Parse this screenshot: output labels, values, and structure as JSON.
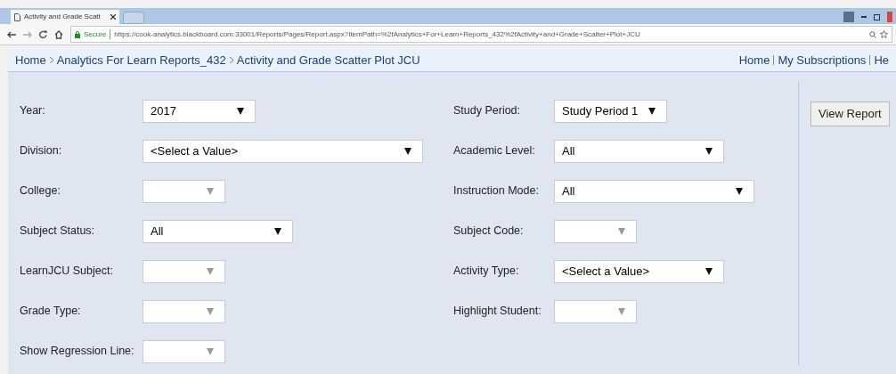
{
  "browser": {
    "tab_title": "Activity and Grade Scatt",
    "secure_label": "Secure",
    "url": "https://cook-analytics.blackboard.com:33001/Reports/Pages/Report.aspx?ItemPath=%2fAnalytics+For+Learn+Reports_432%2fActivity+and+Grade+Scatter+Plot+JCU"
  },
  "breadcrumb": [
    "Home",
    "Analytics For Learn Reports_432",
    "Activity and Grade Scatter Plot JCU"
  ],
  "top_links": [
    "Home",
    "My Subscriptions",
    "He"
  ],
  "parameters_left": [
    {
      "label": "Year:",
      "value": "2017",
      "disabled": false
    },
    {
      "label": "Division:",
      "value": "<Select a Value>",
      "disabled": false
    },
    {
      "label": "College:",
      "disabled": true
    },
    {
      "label": "Subject Status:",
      "value": "All",
      "disabled": false
    },
    {
      "label": "LearnJCU Subject:",
      "disabled": true
    },
    {
      "label": "Grade Type:",
      "disabled": true
    },
    {
      "label": "Show Regression Line:",
      "disabled": true
    }
  ],
  "parameters_right": [
    {
      "label": "Study Period:",
      "value": "Study Period 1",
      "disabled": false
    },
    {
      "label": "Academic Level:",
      "value": "All",
      "disabled": false
    },
    {
      "label": "Instruction Mode:",
      "value": "All",
      "disabled": false
    },
    {
      "label": "Subject Code:",
      "disabled": true
    },
    {
      "label": "Activity Type:",
      "value": "<Select a Value>",
      "disabled": false
    },
    {
      "label": "Highlight Student:",
      "disabled": true
    }
  ],
  "view_report_button": "View Report"
}
